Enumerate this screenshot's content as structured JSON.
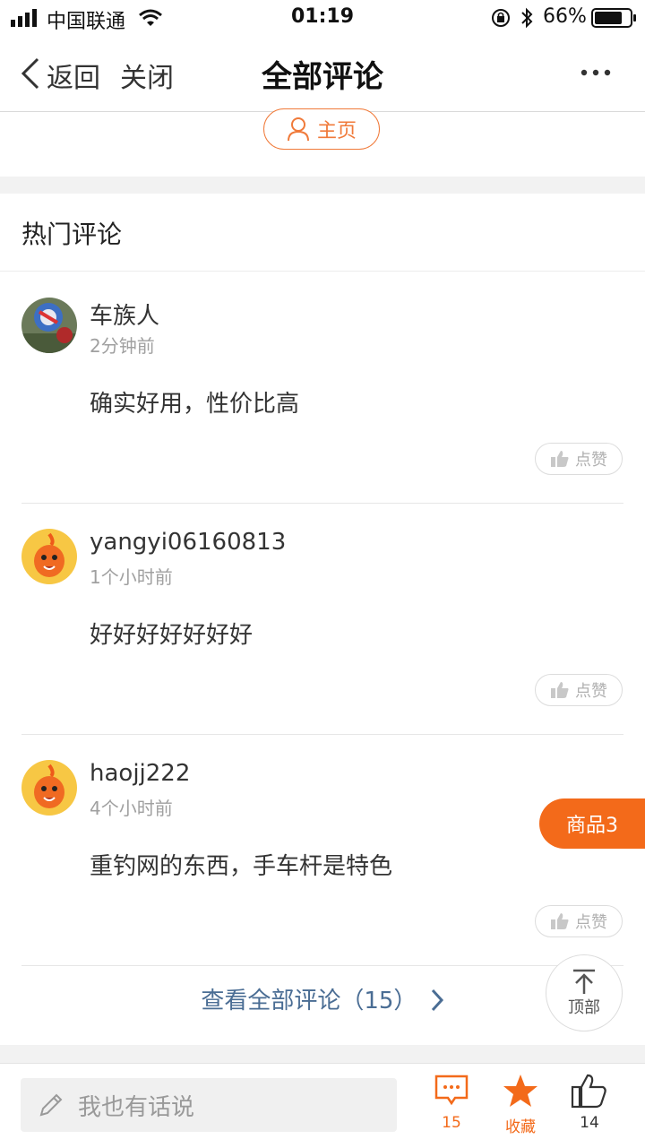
{
  "status_bar": {
    "carrier": "中国联通",
    "time": "01:19",
    "battery": "66%"
  },
  "nav": {
    "back_label": "返回",
    "close_label": "关闭",
    "title": "全部评论"
  },
  "homepage_button": {
    "label": "主页"
  },
  "comments_section": {
    "title": "热门评论",
    "items": [
      {
        "name": "车族人",
        "time": "2分钟前",
        "text": "确实好用，性价比高",
        "like_label": "点赞",
        "avatar": "photo-avatar-icon"
      },
      {
        "name": "yangyi06160813",
        "time": "1个小时前",
        "text": "好好好好好好好",
        "like_label": "点赞",
        "avatar": "mascot-avatar-icon"
      },
      {
        "name": "haojj222",
        "time": "4个小时前",
        "text": "重钓网的东西，手车杆是特色",
        "like_label": "点赞",
        "avatar": "mascot-avatar-icon"
      }
    ],
    "view_all": "查看全部评论（15）"
  },
  "goods_tab": {
    "label": "商品3"
  },
  "top_button": {
    "label": "顶部"
  },
  "bottom_bar": {
    "input_placeholder": "我也有话说",
    "comment_count": "15",
    "favorite_label": "收藏",
    "like_count": "14"
  },
  "colors": {
    "accent": "#f36a1a",
    "link": "#4a6d94",
    "muted": "#a0a0a0"
  }
}
